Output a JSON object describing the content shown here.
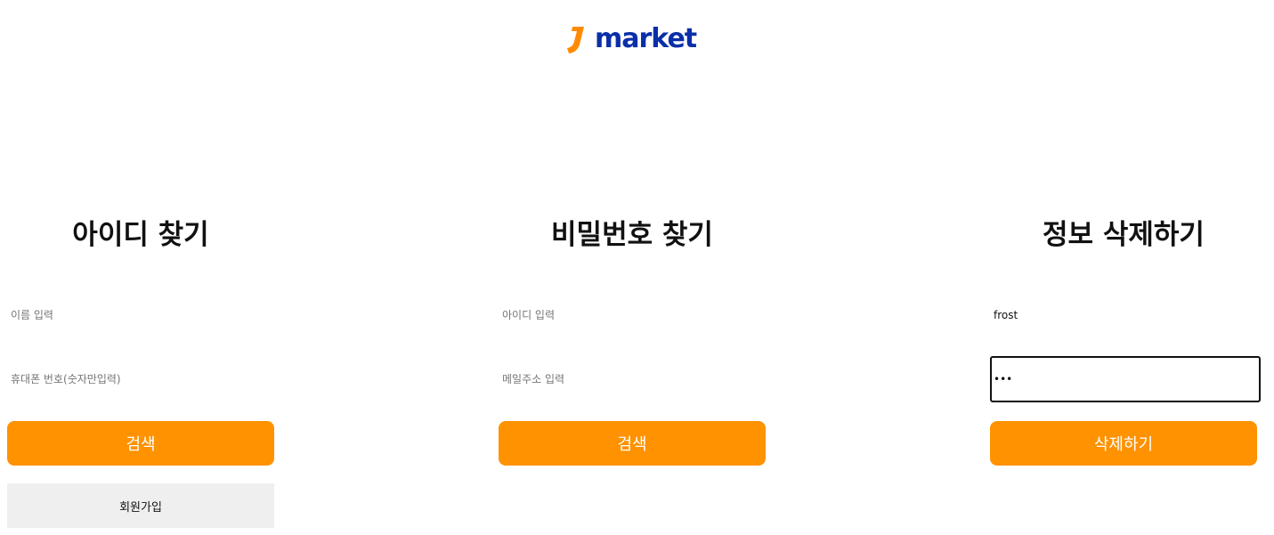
{
  "brand": {
    "name": "market",
    "accent_color": "#ff8a00",
    "text_color": "#0a2fa8"
  },
  "find_id": {
    "title": "아이디 찾기",
    "name_placeholder": "이름 입력",
    "phone_placeholder": "휴대폰 번호(숫자만입력)",
    "search_label": "검색",
    "signup_label": "회원가입"
  },
  "find_password": {
    "title": "비밀번호 찾기",
    "id_placeholder": "아이디 입력",
    "email_placeholder": "메일주소 입력",
    "search_label": "검색"
  },
  "delete_account": {
    "title": "정보 삭제하기",
    "id_value": "frost",
    "password_value": "***",
    "delete_label": "삭제하기"
  },
  "colors": {
    "button_primary": "#ff9200",
    "button_secondary": "#efefef"
  }
}
